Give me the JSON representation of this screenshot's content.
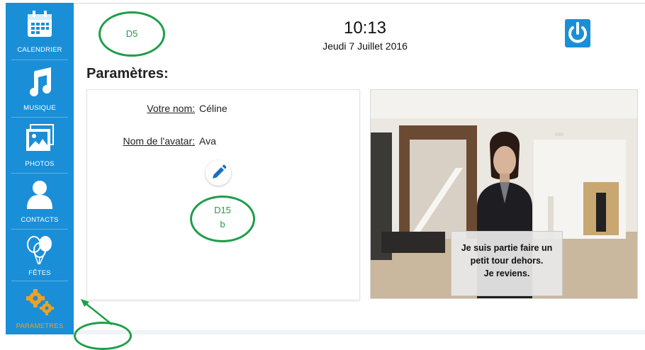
{
  "sidebar": {
    "items": [
      {
        "label": "CALENDRIER",
        "icon": "calendar-icon"
      },
      {
        "label": "MUSIQUE",
        "icon": "music-note-icon"
      },
      {
        "label": "PHOTOS",
        "icon": "photo-icon"
      },
      {
        "label": "CONTACTS",
        "icon": "person-icon"
      },
      {
        "label": "FÊTES",
        "icon": "balloons-icon"
      },
      {
        "label": "PARAMETRES",
        "icon": "gears-icon"
      }
    ],
    "active": "PARAMETRES"
  },
  "header": {
    "time": "10:13",
    "date": "Jeudi 7 Juillet 2016",
    "power_icon": "power-icon"
  },
  "annotations": {
    "d5": "D5",
    "d15_line1": "D15",
    "d15_line2": "b",
    "color": "#1e9e48"
  },
  "page": {
    "title": "Paramètres:"
  },
  "settings": {
    "name_label": "Votre nom:",
    "name_value": "Céline",
    "avatar_label": "Nom de l'avatar:",
    "avatar_value": "Ava",
    "edit_icon": "pencil-icon"
  },
  "avatar_scene": {
    "message_line1": "Je suis partie faire un",
    "message_line2": "petit tour dehors.",
    "message_line3": "Je reviens."
  },
  "colors": {
    "sidebar": "#1a8fd8",
    "active_label": "#f0a020"
  }
}
